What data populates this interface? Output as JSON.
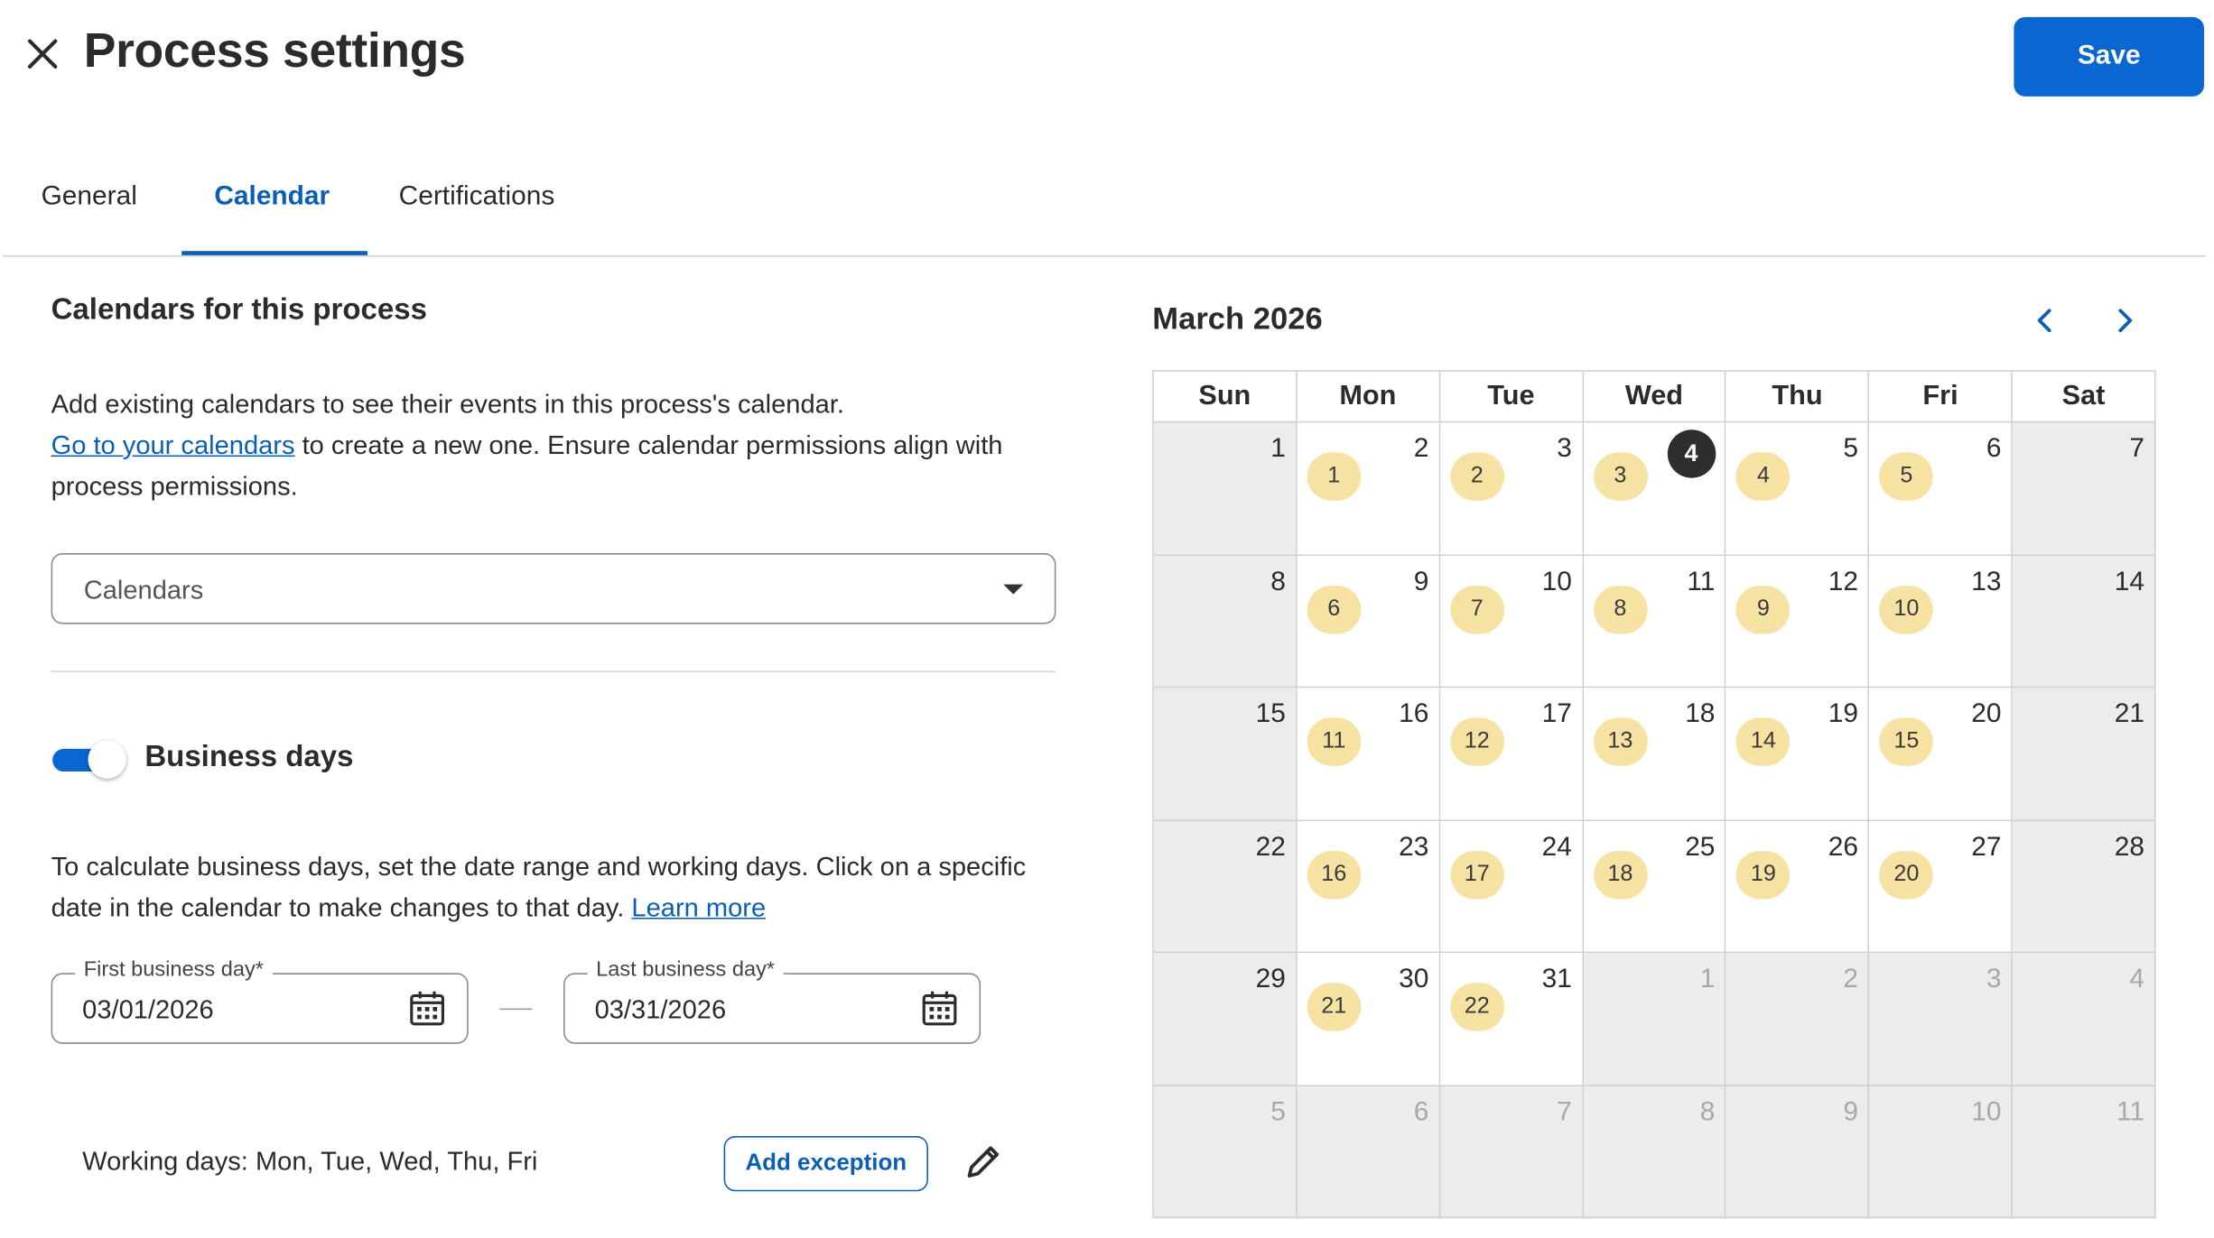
{
  "header": {
    "title": "Process settings",
    "save_label": "Save"
  },
  "tabs": [
    {
      "label": "General",
      "active": false
    },
    {
      "label": "Calendar",
      "active": true
    },
    {
      "label": "Certifications",
      "active": false
    }
  ],
  "calendars_section": {
    "title": "Calendars for this process",
    "description_before_link": "Add existing calendars to see their events in this process's calendar.",
    "link_text": "Go to your calendars",
    "description_after_link": "to create a new one. Ensure calendar permissions align with process permissions.",
    "select_placeholder": "Calendars"
  },
  "business_days": {
    "toggle_on": true,
    "title": "Business days",
    "description": "To calculate business days, set the date range and working days. Click on a specific date in the calendar to make changes to that day.",
    "learn_more": "Learn more",
    "first_day_label": "First business day",
    "first_day_value": "03/01/2026",
    "last_day_label": "Last business day",
    "last_day_value": "03/31/2026",
    "required_marker": "*",
    "working_days": "Working days: Mon, Tue, Wed, Thu, Fri",
    "add_exception_label": "Add exception"
  },
  "calendar": {
    "month_label": "March 2026",
    "weekdays": [
      "Sun",
      "Mon",
      "Tue",
      "Wed",
      "Thu",
      "Fri",
      "Sat"
    ],
    "today": "4",
    "weeks": [
      [
        {
          "day": "1",
          "badge": null,
          "off": true
        },
        {
          "day": "2",
          "badge": "1"
        },
        {
          "day": "3",
          "badge": "2"
        },
        {
          "day": "4",
          "badge": "3",
          "today": true
        },
        {
          "day": "5",
          "badge": "4"
        },
        {
          "day": "6",
          "badge": "5"
        },
        {
          "day": "7",
          "badge": null,
          "off": true
        }
      ],
      [
        {
          "day": "8",
          "badge": null,
          "off": true
        },
        {
          "day": "9",
          "badge": "6"
        },
        {
          "day": "10",
          "badge": "7"
        },
        {
          "day": "11",
          "badge": "8"
        },
        {
          "day": "12",
          "badge": "9"
        },
        {
          "day": "13",
          "badge": "10"
        },
        {
          "day": "14",
          "badge": null,
          "off": true
        }
      ],
      [
        {
          "day": "15",
          "badge": null,
          "off": true
        },
        {
          "day": "16",
          "badge": "11"
        },
        {
          "day": "17",
          "badge": "12"
        },
        {
          "day": "18",
          "badge": "13"
        },
        {
          "day": "19",
          "badge": "14"
        },
        {
          "day": "20",
          "badge": "15"
        },
        {
          "day": "21",
          "badge": null,
          "off": true
        }
      ],
      [
        {
          "day": "22",
          "badge": null,
          "off": true
        },
        {
          "day": "23",
          "badge": "16"
        },
        {
          "day": "24",
          "badge": "17"
        },
        {
          "day": "25",
          "badge": "18"
        },
        {
          "day": "26",
          "badge": "19"
        },
        {
          "day": "27",
          "badge": "20"
        },
        {
          "day": "28",
          "badge": null,
          "off": true
        }
      ],
      [
        {
          "day": "29",
          "badge": null,
          "off": true
        },
        {
          "day": "30",
          "badge": "21"
        },
        {
          "day": "31",
          "badge": "22"
        },
        {
          "day": "1",
          "badge": null,
          "off": true,
          "outside": true
        },
        {
          "day": "2",
          "badge": null,
          "off": true,
          "outside": true
        },
        {
          "day": "3",
          "badge": null,
          "off": true,
          "outside": true
        },
        {
          "day": "4",
          "badge": null,
          "off": true,
          "outside": true
        }
      ],
      [
        {
          "day": "5",
          "badge": null,
          "off": true,
          "outside": true
        },
        {
          "day": "6",
          "badge": null,
          "off": true,
          "outside": true
        },
        {
          "day": "7",
          "badge": null,
          "off": true,
          "outside": true
        },
        {
          "day": "8",
          "badge": null,
          "off": true,
          "outside": true
        },
        {
          "day": "9",
          "badge": null,
          "off": true,
          "outside": true
        },
        {
          "day": "10",
          "badge": null,
          "off": true,
          "outside": true
        },
        {
          "day": "11",
          "badge": null,
          "off": true,
          "outside": true
        }
      ]
    ]
  },
  "icons": {
    "close": "close-icon",
    "dropdown": "caret-down-icon",
    "date_picker": "calendar-icon",
    "edit": "pencil-icon",
    "prev": "chevron-left-icon",
    "next": "chevron-right-icon"
  },
  "colors": {
    "primary": "#0a66d0",
    "link": "#0a5fb4",
    "badge": "#f6e2a3",
    "non_working": "#ececec",
    "today": "#2e2e2e"
  }
}
